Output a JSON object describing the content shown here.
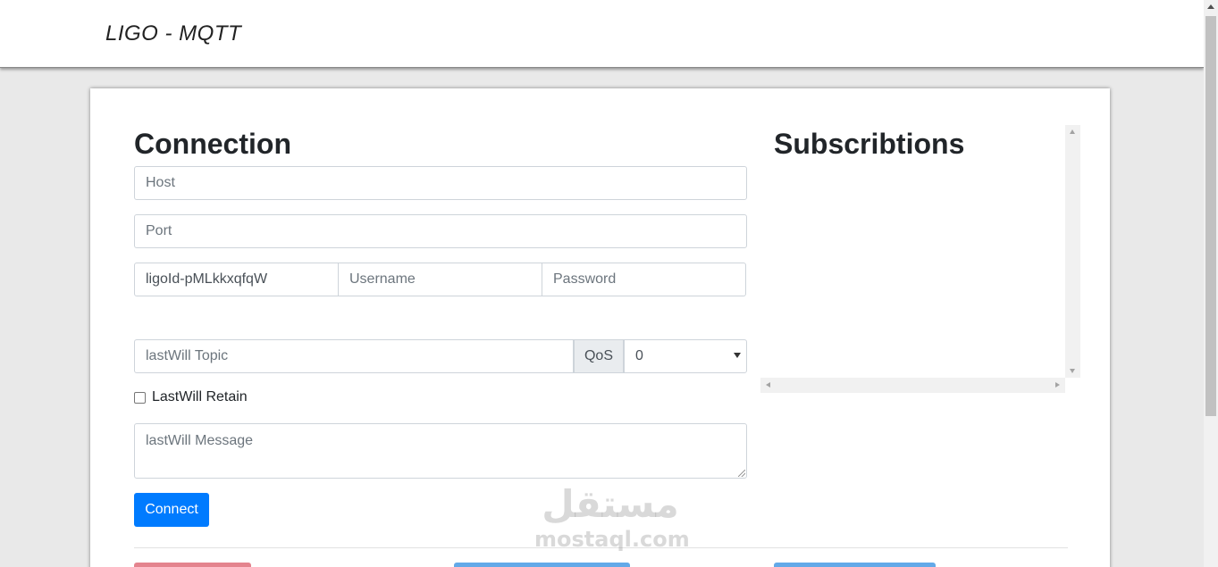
{
  "app": {
    "brand": "LIGO - MQTT"
  },
  "connection": {
    "title": "Connection",
    "host_placeholder": "Host",
    "port_placeholder": "Port",
    "client_id_value": "ligoId-pMLkkxqfqW",
    "username_placeholder": "Username",
    "password_placeholder": "Password",
    "lastwill_topic_placeholder": "lastWill Topic",
    "qos_label": "QoS",
    "qos_selected": "0",
    "lastwill_retain_label": "LastWill Retain",
    "lastwill_message_placeholder": "lastWill Message",
    "connect_label": "Connect"
  },
  "subscriptions": {
    "title": "Subscribtions"
  },
  "watermark": {
    "arabic": "مستقل",
    "latin": "mostaql.com"
  },
  "colors": {
    "primary": "#007bff",
    "danger_faded": "#e4848e",
    "info_faded": "#63a9e8"
  }
}
